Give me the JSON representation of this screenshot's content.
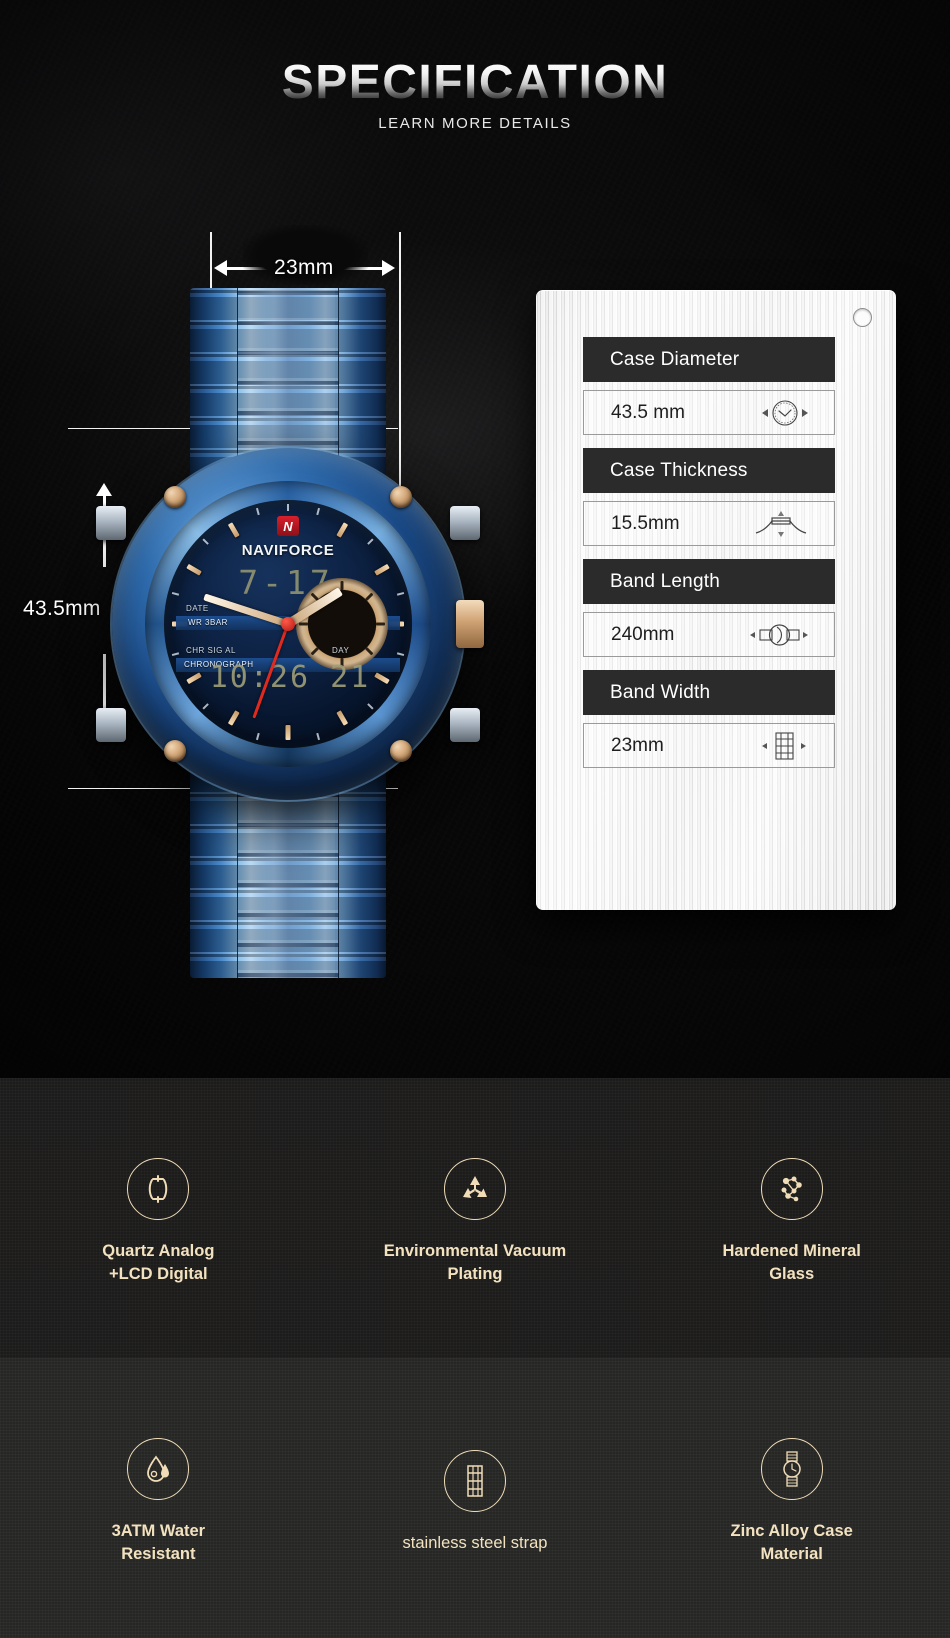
{
  "header": {
    "title": "SPECIFICATION",
    "subtitle": "LEARN MORE DETAILS"
  },
  "product": {
    "brand_logo": "N",
    "brand_name": "NAVIFORCE",
    "lcd_top": "7-17",
    "lcd_bottom": "10:26 21",
    "dial_labels": {
      "date": "DATE",
      "water_resist": "WR 3BAR",
      "alarm_row": "CHR SIG AL",
      "chronograph": "CHRONOGRAPH",
      "day": "DAY"
    }
  },
  "dimensions": {
    "width_label": "23mm",
    "height_label": "43.5mm"
  },
  "spec_panel": {
    "rows": [
      {
        "label": "Case Diameter",
        "value": "43.5 mm",
        "icon": "watch-face-icon"
      },
      {
        "label": "Case Thickness",
        "value": "15.5mm",
        "icon": "case-profile-icon"
      },
      {
        "label": "Band Length",
        "value": "240mm",
        "icon": "watch-band-icon"
      },
      {
        "label": "Band Width",
        "value": "23mm",
        "icon": "band-links-icon"
      }
    ]
  },
  "features": {
    "row_one": [
      {
        "icon": "watch-case-icon",
        "line1": "Quartz Analog",
        "line2": "+LCD Digital",
        "bold": true
      },
      {
        "icon": "recycle-icon",
        "line1": "Environmental Vacuum",
        "line2": "Plating",
        "bold": true
      },
      {
        "icon": "molecule-icon",
        "line1": "Hardened Mineral",
        "line2": "Glass",
        "bold": true
      }
    ],
    "row_two": [
      {
        "icon": "water-drop-icon",
        "line1": "3ATM Water",
        "line2": "Resistant",
        "bold": true
      },
      {
        "icon": "band-links-icon",
        "line1": "stainless steel strap",
        "line2": "",
        "bold": false
      },
      {
        "icon": "wristwatch-icon",
        "line1": "Zinc Alloy Case",
        "line2": "Material",
        "bold": true
      }
    ]
  },
  "colors": {
    "accent_cream": "#f3e2bf",
    "panel_header": "#2b2b2b",
    "watch_blue": "#2f6cae",
    "second_hand_red": "#e02a20"
  }
}
